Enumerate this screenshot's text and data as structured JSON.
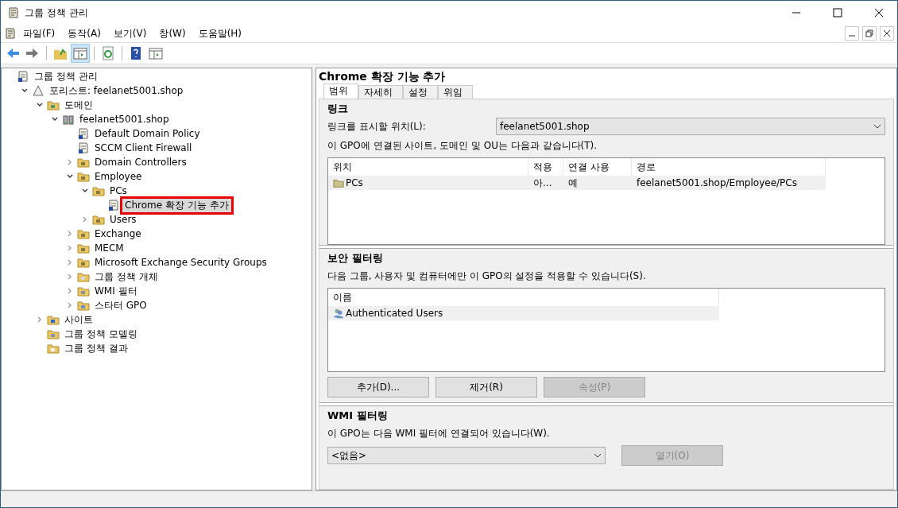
{
  "window": {
    "title": "그룹 정책 관리"
  },
  "menu": [
    "파일(F)",
    "동작(A)",
    "보기(V)",
    "창(W)",
    "도움말(H)"
  ],
  "toolbar": [
    {
      "kind": "back",
      "selected": false
    },
    {
      "kind": "forward",
      "selected": false
    },
    {
      "kind": "sep"
    },
    {
      "kind": "up",
      "selected": false
    },
    {
      "kind": "pane",
      "selected": true
    },
    {
      "kind": "sep"
    },
    {
      "kind": "refresh",
      "selected": false
    },
    {
      "kind": "sep"
    },
    {
      "kind": "help",
      "selected": false
    },
    {
      "kind": "pane2",
      "selected": false
    }
  ],
  "tree": [
    {
      "label": "그룹 정책 관리",
      "kind": "console",
      "children": [
        {
          "label": "포리스트: feelanet5001.shop",
          "kind": "forest",
          "expanded": true,
          "children": [
            {
              "label": "도메인",
              "kind": "domains",
              "expanded": true,
              "children": [
                {
                  "label": "feelanet5001.shop",
                  "kind": "domain",
                  "expanded": true,
                  "children": [
                    {
                      "label": "Default Domain Policy",
                      "kind": "gpo"
                    },
                    {
                      "label": "SCCM Client Firewall",
                      "kind": "gpo"
                    },
                    {
                      "label": "Domain Controllers",
                      "kind": "ou",
                      "expanded": false
                    },
                    {
                      "label": "Employee",
                      "kind": "ou",
                      "expanded": true,
                      "children": [
                        {
                          "label": "PCs",
                          "kind": "ou",
                          "expanded": true,
                          "children": [
                            {
                              "label": "Chrome 확장 기능 추가",
                              "kind": "gpo",
                              "selected": true
                            }
                          ]
                        },
                        {
                          "label": "Users",
                          "kind": "ou",
                          "expanded": false
                        }
                      ]
                    },
                    {
                      "label": "Exchange",
                      "kind": "ou",
                      "expanded": false
                    },
                    {
                      "label": "MECM",
                      "kind": "ou",
                      "expanded": false
                    },
                    {
                      "label": "Microsoft Exchange Security Groups",
                      "kind": "ou",
                      "expanded": false
                    },
                    {
                      "label": "그룹 정책 개체",
                      "kind": "gpofolder",
                      "expanded": false
                    },
                    {
                      "label": "WMI 필터",
                      "kind": "wmi",
                      "expanded": false
                    },
                    {
                      "label": "스타터 GPO",
                      "kind": "starter",
                      "expanded": false
                    }
                  ]
                }
              ]
            },
            {
              "label": "사이트",
              "kind": "sites",
              "expanded": false
            },
            {
              "label": "그룹 정책 모델링",
              "kind": "modeling"
            },
            {
              "label": "그룹 정책 결과",
              "kind": "results"
            }
          ]
        }
      ]
    }
  ],
  "detail": {
    "title": "Chrome 확장 기능 추가",
    "tabs": [
      {
        "label": "범위",
        "selected": true
      },
      {
        "label": "자세히",
        "selected": false
      },
      {
        "label": "설정",
        "selected": false
      },
      {
        "label": "위임",
        "selected": false
      }
    ],
    "links": {
      "heading": "링크",
      "location_label": "링크를 표시할 위치(L):",
      "location_value": "feelanet5001.shop",
      "description": "이 GPO에 연결된 사이트, 도메인 및 OU는 다음과 같습니다(T).",
      "columns": [
        "위치",
        "적용",
        "연결 사용",
        "경로"
      ],
      "rows": [
        {
          "cells": [
            "PCs",
            "아...",
            "예",
            "feelanet5001.shop/Employee/PCs"
          ]
        }
      ]
    },
    "security": {
      "heading": "보안 필터링",
      "description": "다음 그룹, 사용자 및 컴퓨터에만 이 GPO의 설정을 적용할 수 있습니다(S).",
      "columns": [
        "이름"
      ],
      "rows": [
        {
          "cells": [
            "Authenticated Users"
          ]
        }
      ],
      "buttons": [
        {
          "label": "추가(D)...",
          "disabled": false
        },
        {
          "label": "제거(R)",
          "disabled": false
        },
        {
          "label": "속성(P)",
          "disabled": true
        }
      ]
    },
    "wmi": {
      "heading": "WMI 필터링",
      "description": "이 GPO는 다음 WMI 필터에 연결되어 있습니다(W).",
      "value": "<없음>",
      "button": {
        "label": "열기(O)",
        "disabled": true
      }
    }
  }
}
